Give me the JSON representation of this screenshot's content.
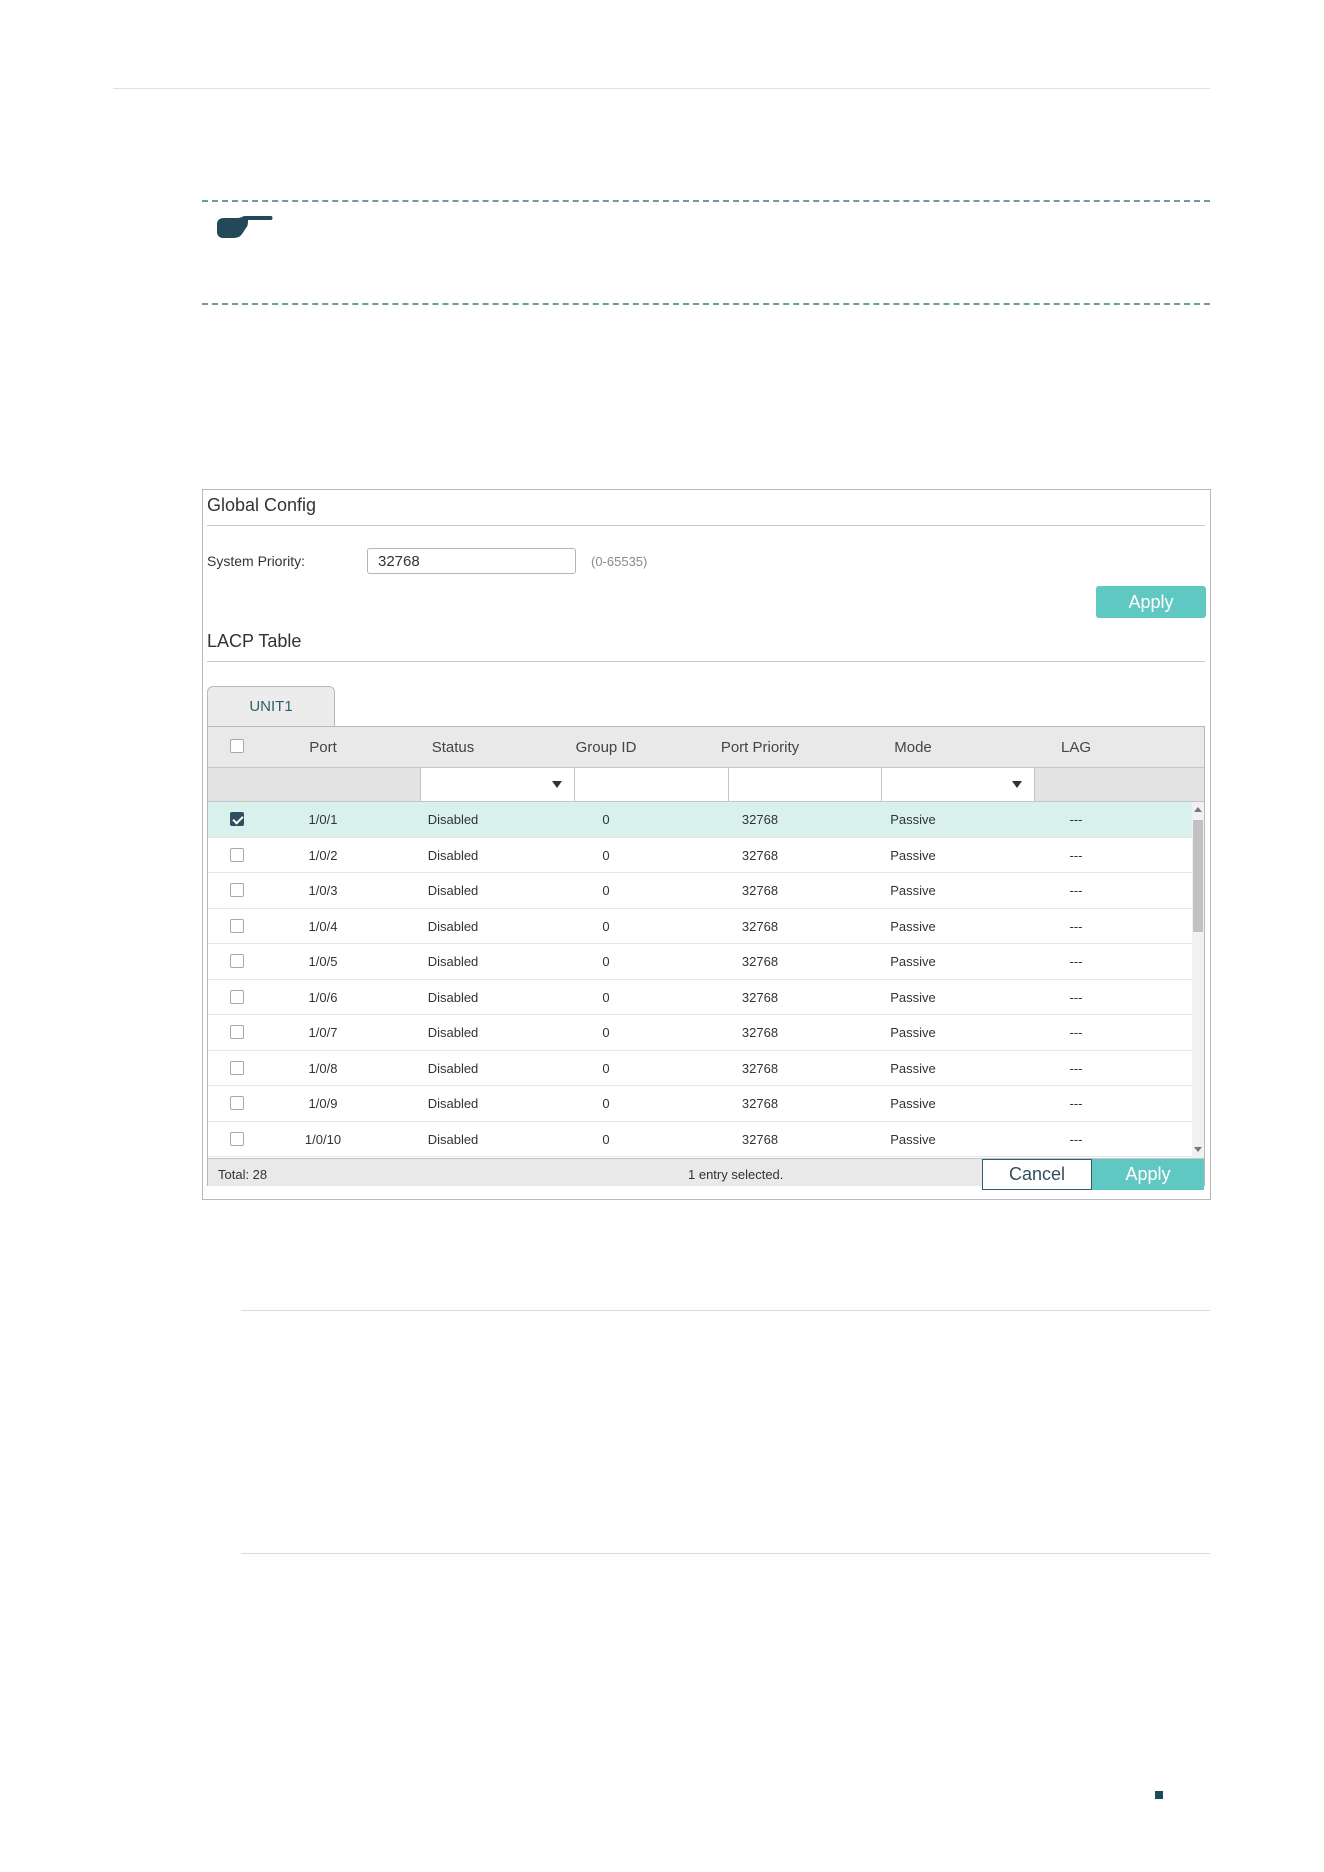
{
  "global_config": {
    "title": "Global Config",
    "system_priority_label": "System Priority:",
    "system_priority_value": "32768",
    "system_priority_hint": "(0-65535)",
    "apply_label": "Apply"
  },
  "lacp_table": {
    "title": "LACP Table",
    "tab_label": "UNIT1",
    "columns": [
      "Port",
      "Status",
      "Group ID",
      "Port Priority",
      "Mode",
      "LAG"
    ],
    "rows": [
      {
        "port": "1/0/1",
        "status": "Disabled",
        "group_id": "0",
        "priority": "32768",
        "mode": "Passive",
        "lag": "---",
        "checked": true
      },
      {
        "port": "1/0/2",
        "status": "Disabled",
        "group_id": "0",
        "priority": "32768",
        "mode": "Passive",
        "lag": "---",
        "checked": false
      },
      {
        "port": "1/0/3",
        "status": "Disabled",
        "group_id": "0",
        "priority": "32768",
        "mode": "Passive",
        "lag": "---",
        "checked": false
      },
      {
        "port": "1/0/4",
        "status": "Disabled",
        "group_id": "0",
        "priority": "32768",
        "mode": "Passive",
        "lag": "---",
        "checked": false
      },
      {
        "port": "1/0/5",
        "status": "Disabled",
        "group_id": "0",
        "priority": "32768",
        "mode": "Passive",
        "lag": "---",
        "checked": false
      },
      {
        "port": "1/0/6",
        "status": "Disabled",
        "group_id": "0",
        "priority": "32768",
        "mode": "Passive",
        "lag": "---",
        "checked": false
      },
      {
        "port": "1/0/7",
        "status": "Disabled",
        "group_id": "0",
        "priority": "32768",
        "mode": "Passive",
        "lag": "---",
        "checked": false
      },
      {
        "port": "1/0/8",
        "status": "Disabled",
        "group_id": "0",
        "priority": "32768",
        "mode": "Passive",
        "lag": "---",
        "checked": false
      },
      {
        "port": "1/0/9",
        "status": "Disabled",
        "group_id": "0",
        "priority": "32768",
        "mode": "Passive",
        "lag": "---",
        "checked": false
      },
      {
        "port": "1/0/10",
        "status": "Disabled",
        "group_id": "0",
        "priority": "32768",
        "mode": "Passive",
        "lag": "---",
        "checked": false
      }
    ],
    "footer": {
      "total": "Total: 28",
      "selected": "1 entry selected.",
      "cancel_label": "Cancel",
      "apply_label": "Apply"
    }
  },
  "colors": {
    "accent": "#5fc8c2",
    "selected_row": "#d8f1ec",
    "dark": "#2d4f5e"
  },
  "icons": {
    "note": "pointing-hand-icon"
  }
}
